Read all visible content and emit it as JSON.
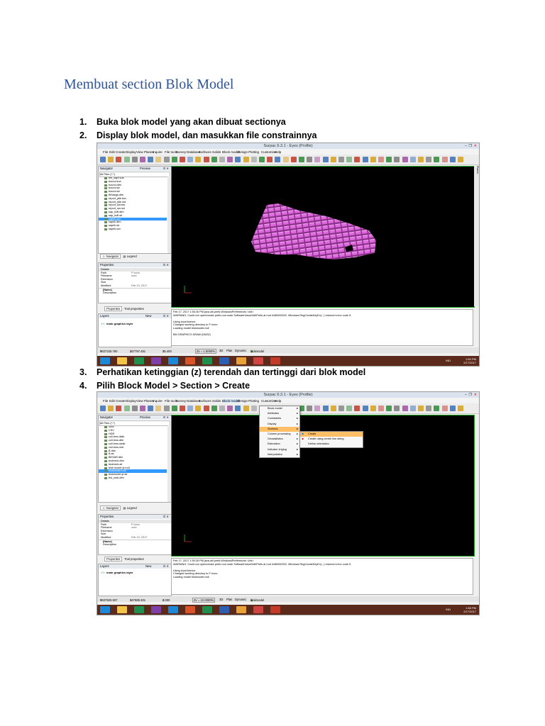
{
  "doc": {
    "title": "Membuat section Blok Model",
    "steps": [
      {
        "num": "1.",
        "text": "Buka blok model yang akan dibuat sectionya"
      },
      {
        "num": "2.",
        "text": "Display blok model, dan masukkan file constrainnya"
      },
      {
        "num": "3.",
        "text": "Perhatikan ketinggian (z) terendah dan tertinggi dari blok model"
      },
      {
        "num": "4.",
        "text": "Pilih Block Model > Section  > Create"
      }
    ]
  },
  "shot1": {
    "window_title": "Surpac 6.3.1 - Eyes (Profile)",
    "menu": [
      "File",
      "Edit",
      "Create",
      "Display",
      "View",
      "Planes",
      "Inquire",
      "File tools",
      "Survey",
      "Database",
      "Surfaces",
      "Solids",
      "Block model",
      "Design",
      "Plotting",
      "Customise",
      "Help"
    ],
    "navigator_label": "Navigator",
    "preview_label": "Preview",
    "filter": "All Files (*.*)",
    "files": [
      "bm_sapf.cus",
      "bound.sun",
      "bound.dtm",
      "bound.str",
      "bound.str",
      "Bfndsgs.dtm",
      "report_jdle.bsv",
      "report_jdle.rsd",
      "report_sw.bsv",
      "report_sw.rsd",
      "sap_bdll.dtm",
      "sap_bdll.str",
      "saprik.sun",
      "saprik.dtm",
      "saprik.str",
      "saprik.sun"
    ],
    "selected_file_index": 12,
    "tab_navigator": "Navigator",
    "tab_legend": "Legend",
    "properties_label": "Properties",
    "props": [
      [
        "Details",
        ""
      ],
      [
        "Path",
        "F:\\xxxx"
      ],
      [
        "Filename",
        "xxxx"
      ],
      [
        "Extension",
        ""
      ],
      [
        "Size",
        ""
      ],
      [
        "Modified",
        "Feb 10, 2017"
      ]
    ],
    "props_foot": [
      "(Name)",
      "Description"
    ],
    "tab_properties": "Properties",
    "tab_toolprops": "Tool properties",
    "layers_label": "Layers",
    "layers_new": "New",
    "layer_name": "main graphics layer",
    "console": [
      "Feb 17, 2017 1:50:26 PM java.util.prefs.WindowsPreferences <init>",
      "WARNING: Could not open/create prefs root node Software\\JavaSoft\\Prefs at root 0x80000002. Windows RegCreateKeyEx(...) returned error code 5.",
      "",
      "Using local licence",
      "Changed working directory to F:\\xxxx",
      "Loading model blokmodel.mdl",
      "",
      "BM GRAPHICS DRAW (DM32)"
    ],
    "status": {
      "y": "9637225.780",
      "x": "347797.481",
      "z": "35.400",
      "zoom": "Zv = 1.5000%",
      "mode1": "3D",
      "mode2": "Plan",
      "mode3": "Dynamic",
      "model": "blokmodel"
    },
    "clock": {
      "time": "1:50 PM",
      "date": "2/17/2017",
      "lang": "IND"
    },
    "planes_label": "Planes"
  },
  "shot2": {
    "window_title": "Surpac 6.3.1 - Eyes (Profile)",
    "menu": [
      "File",
      "Edit",
      "Create",
      "Display",
      "View",
      "Planes",
      "Inquire",
      "File tools",
      "Survey",
      "Database",
      "Surfaces",
      "Solids",
      "Block model",
      "Design",
      "Plotting",
      "Customise",
      "Help"
    ],
    "navigator_label": "Navigator",
    "preview_label": "Preview",
    "filter": "All Files (*.*)",
    "files": [
      "xxxx",
      "CSV",
      "HDR",
      "coll.bmx.dtdb",
      "coll.bms.dtm",
      "coll.bms.strdb",
      "coll.bms.mst",
      "B.dtm",
      "B.str",
      "BESAR.dtm",
      "bndneck.dtm",
      "bndneck.str",
      "blok model yt.mdl",
      "blokmodel.mdl",
      "blokmodel.yt.str",
      "bsl_sorb.dtm"
    ],
    "selected_file_index": 13,
    "tab_navigator": "Navigator",
    "tab_legend": "Legend",
    "properties_label": "Properties",
    "props": [
      [
        "Details",
        ""
      ],
      [
        "Path",
        "F:\\xxxx"
      ],
      [
        "Filename",
        "xxxx"
      ],
      [
        "Extension",
        ""
      ],
      [
        "Size",
        ""
      ],
      [
        "Modified",
        "Feb 10, 2017"
      ]
    ],
    "props_foot": [
      "(Name)",
      "Description"
    ],
    "tab_properties": "Properties",
    "tab_toolprops": "Tool properties",
    "layers_label": "Layers",
    "layers_new": "New",
    "layer_name": "main graphics layer",
    "bm_menu": [
      "Block model",
      "Attributes",
      "Constraints",
      "Display",
      "Sections",
      "Column processing",
      "Geostatistics",
      "Estimation",
      "Indicator kriging",
      "Interpolation"
    ],
    "bm_menu_highlight": 4,
    "sections_sub": [
      "Create",
      "Create using centre line string",
      "Define orientation"
    ],
    "console": [
      "Feb 17, 2017 1:50:26 PM java.util.prefs.WindowsPreferences <init>",
      "WARNING: Could not open/create prefs root node Software\\JavaSoft\\Prefs at root 0x80000002. Windows RegCreateKeyEx(...) returned error code 5.",
      "",
      "Using local licence",
      "Changed working directory to F:\\xxxx",
      "Loading model blokmodel.mdl"
    ],
    "status": {
      "y": "9637500.507",
      "x": "347989.301",
      "z": "0.000",
      "zoom": "Zv = 10.0000%",
      "mode1": "3D",
      "mode2": "Plan",
      "mode3": "Dynamic",
      "model": "blokmodel"
    },
    "clock": {
      "time": "1:58 PM",
      "date": "2/17/2017",
      "lang": "IND"
    }
  },
  "colors": {
    "title": "#2f5496",
    "viewport_border": "#22aa22",
    "block": "#d966d9",
    "highlight": "#ffbf66",
    "taskbar": "#5b2a1b"
  }
}
